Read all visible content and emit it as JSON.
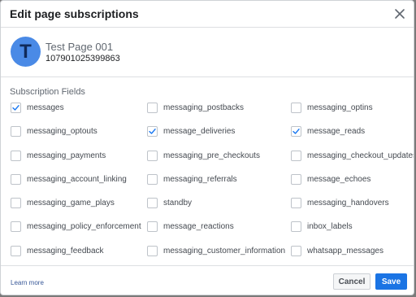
{
  "dialog": {
    "title": "Edit page subscriptions",
    "close_icon": "close-icon"
  },
  "page": {
    "avatar_letter": "T",
    "name": "Test Page 001",
    "id": "107901025399863"
  },
  "subscription_fields_label": "Subscription Fields",
  "fields": [
    {
      "label": "messages",
      "checked": true
    },
    {
      "label": "messaging_postbacks",
      "checked": false
    },
    {
      "label": "messaging_optins",
      "checked": false
    },
    {
      "label": "messaging_optouts",
      "checked": false
    },
    {
      "label": "message_deliveries",
      "checked": true
    },
    {
      "label": "message_reads",
      "checked": true
    },
    {
      "label": "messaging_payments",
      "checked": false
    },
    {
      "label": "messaging_pre_checkouts",
      "checked": false
    },
    {
      "label": "messaging_checkout_updates",
      "checked": false
    },
    {
      "label": "messaging_account_linking",
      "checked": false
    },
    {
      "label": "messaging_referrals",
      "checked": false
    },
    {
      "label": "message_echoes",
      "checked": false
    },
    {
      "label": "messaging_game_plays",
      "checked": false
    },
    {
      "label": "standby",
      "checked": false
    },
    {
      "label": "messaging_handovers",
      "checked": false
    },
    {
      "label": "messaging_policy_enforcement",
      "checked": false
    },
    {
      "label": "message_reactions",
      "checked": false
    },
    {
      "label": "inbox_labels",
      "checked": false
    },
    {
      "label": "messaging_feedback",
      "checked": false
    },
    {
      "label": "messaging_customer_information",
      "checked": false
    },
    {
      "label": "whatsapp_messages",
      "checked": false
    }
  ],
  "footer": {
    "learn_more": "Learn more",
    "cancel_label": "Cancel",
    "save_label": "Save"
  },
  "colors": {
    "primary": "#1b74e4",
    "avatar": "#4a8ae6",
    "check": "#1877f2"
  }
}
